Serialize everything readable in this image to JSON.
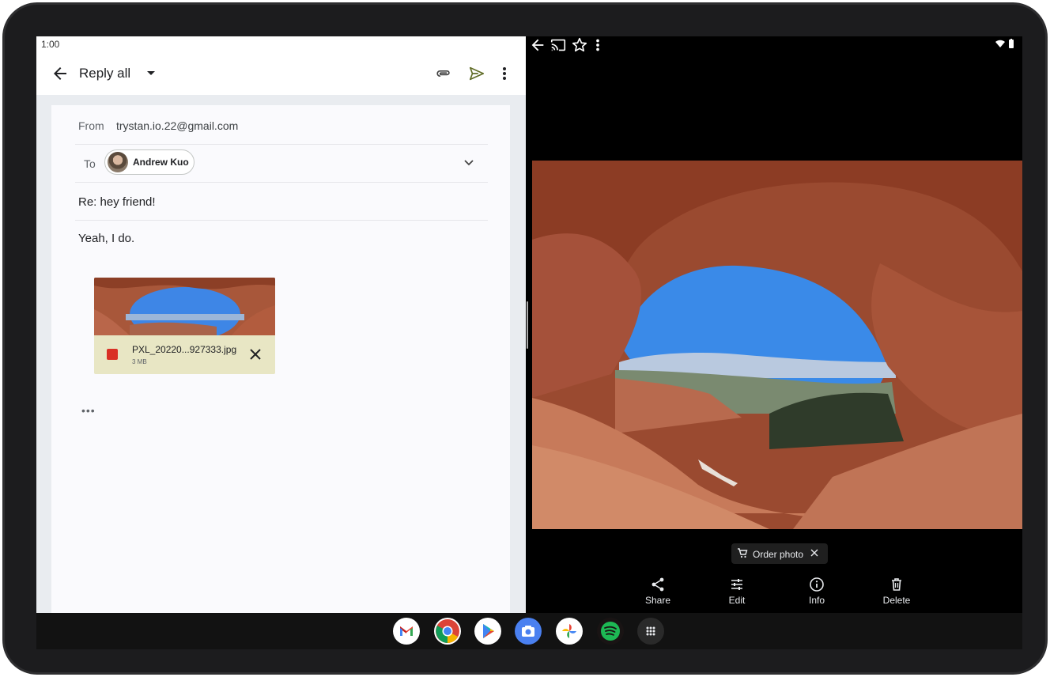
{
  "status_bar": {
    "time": "1:00"
  },
  "gmail": {
    "appbar": {
      "title": "Reply all"
    },
    "compose": {
      "from_label": "From",
      "from_value": "trystan.io.22@gmail.com",
      "to_label": "To",
      "to_recipient": "Andrew Kuo",
      "subject": "Re: hey friend!",
      "body": "Yeah, I do.",
      "attachment": {
        "filename": "PXL_20220...927333.jpg",
        "size": "3 MB"
      },
      "quoted_toggle": "•••"
    }
  },
  "photos": {
    "order_chip": {
      "label": "Order photo"
    },
    "actions": [
      {
        "label": "Share",
        "icon": "share-icon"
      },
      {
        "label": "Edit",
        "icon": "tune-icon"
      },
      {
        "label": "Info",
        "icon": "info-icon"
      },
      {
        "label": "Delete",
        "icon": "trash-icon"
      }
    ]
  },
  "dock": {
    "apps": [
      "gmail-icon",
      "chrome-icon",
      "play-store-icon",
      "camera-icon",
      "photos-icon",
      "spotify-icon",
      "app-drawer-icon"
    ]
  },
  "colors": {
    "gmail_bg": "#e9ecf0",
    "attachment_bg": "#e8e6c4",
    "accent_red": "#d93025",
    "photos_bg": "#000000"
  }
}
